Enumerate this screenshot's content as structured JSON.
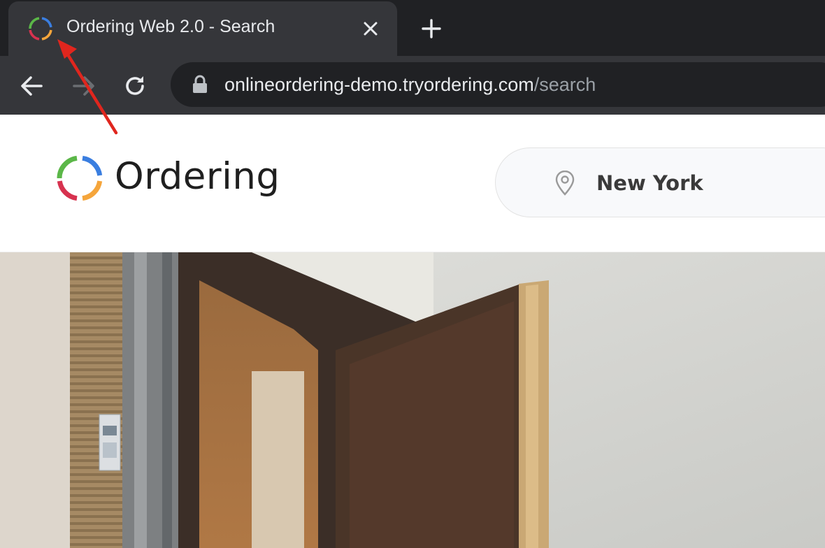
{
  "browser": {
    "tab": {
      "title": "Ordering Web 2.0 - Search",
      "favicon_icon": "ordering-ring-icon",
      "close_icon": "close-icon"
    },
    "new_tab_icon": "plus-icon",
    "nav": {
      "back_icon": "arrow-left-icon",
      "forward_icon": "arrow-right-icon",
      "reload_icon": "reload-icon"
    },
    "address_bar": {
      "lock_icon": "lock-icon",
      "host": "onlineordering-demo.tryordering.com",
      "path": "/search"
    }
  },
  "header": {
    "brand_name": "Ordering",
    "location": {
      "icon": "map-pin-icon",
      "value": "New York"
    }
  },
  "colors": {
    "chrome_dark": "#202124",
    "chrome_tab": "#35363a",
    "ring_green": "#5bb748",
    "ring_blue": "#3a7ee0",
    "ring_orange": "#f5a53b",
    "ring_red": "#d7324f",
    "annotation_red": "#e0261e"
  }
}
